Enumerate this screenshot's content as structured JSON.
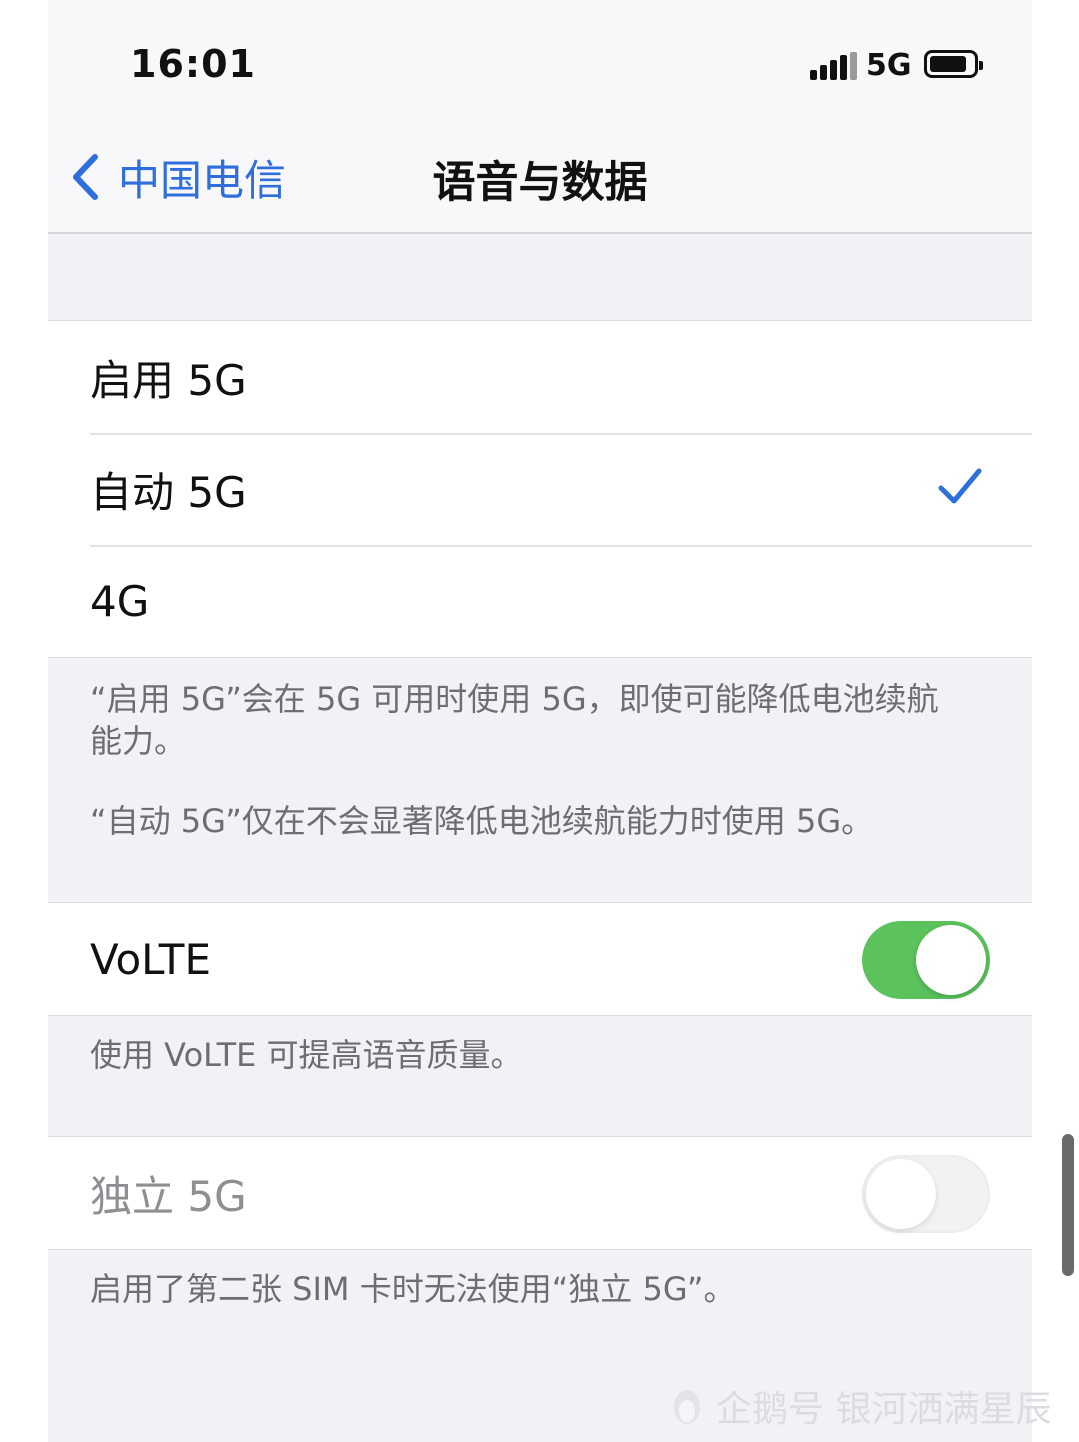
{
  "status_bar": {
    "time": "16:01",
    "network": "5G",
    "icons": [
      "signal-icon",
      "battery-icon"
    ]
  },
  "nav": {
    "back_label": "中国电信",
    "title": "语音与数据"
  },
  "mode_options": {
    "items": [
      {
        "label": "启用 5G",
        "selected": false
      },
      {
        "label": "自动 5G",
        "selected": true
      },
      {
        "label": "4G",
        "selected": false
      }
    ]
  },
  "mode_footer": {
    "line1": "“启用 5G”会在 5G 可用时使用 5G，即使可能降低电池续航能力。",
    "line2": "“自动 5G”仅在不会显著降低电池续航能力时使用 5G。"
  },
  "volte": {
    "label": "VoLTE",
    "enabled": true,
    "footer": "使用 VoLTE 可提高语音质量。"
  },
  "sa5g": {
    "label": "独立 5G",
    "enabled": false,
    "disabled": true,
    "footer": "启用了第二张 SIM 卡时无法使用“独立 5G”。"
  },
  "watermark": "企鹅号 银河洒满星辰",
  "colors": {
    "accent": "#2f6fdc",
    "toggle_on": "#5cc35c",
    "background": "#f2f2f6"
  }
}
